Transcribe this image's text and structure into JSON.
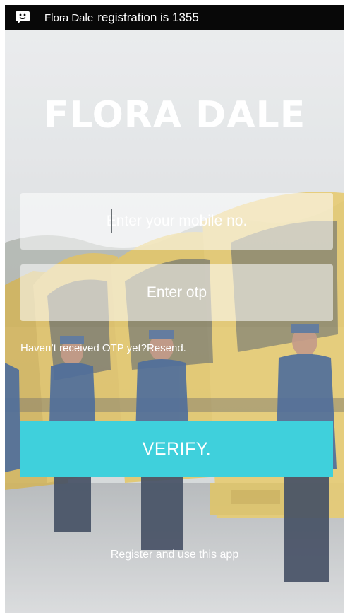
{
  "status_bar": {
    "notification_icon": "message-smiley-icon",
    "app_name": "Flora Dale",
    "message": "registration is 1355"
  },
  "title": "FLORA DALE",
  "mobile_field": {
    "placeholder": "Enter your mobile no.",
    "value": ""
  },
  "otp_field": {
    "placeholder": "Enter otp",
    "value": ""
  },
  "resend": {
    "prompt": "Haven’t received OTP yet?",
    "link_label": "Resend."
  },
  "verify_button": {
    "label": "VERIFY."
  },
  "register_link": "Register and use this app",
  "colors": {
    "status_bar": "#080808",
    "verify_button": "#3fd0dc",
    "text": "#ffffff"
  }
}
